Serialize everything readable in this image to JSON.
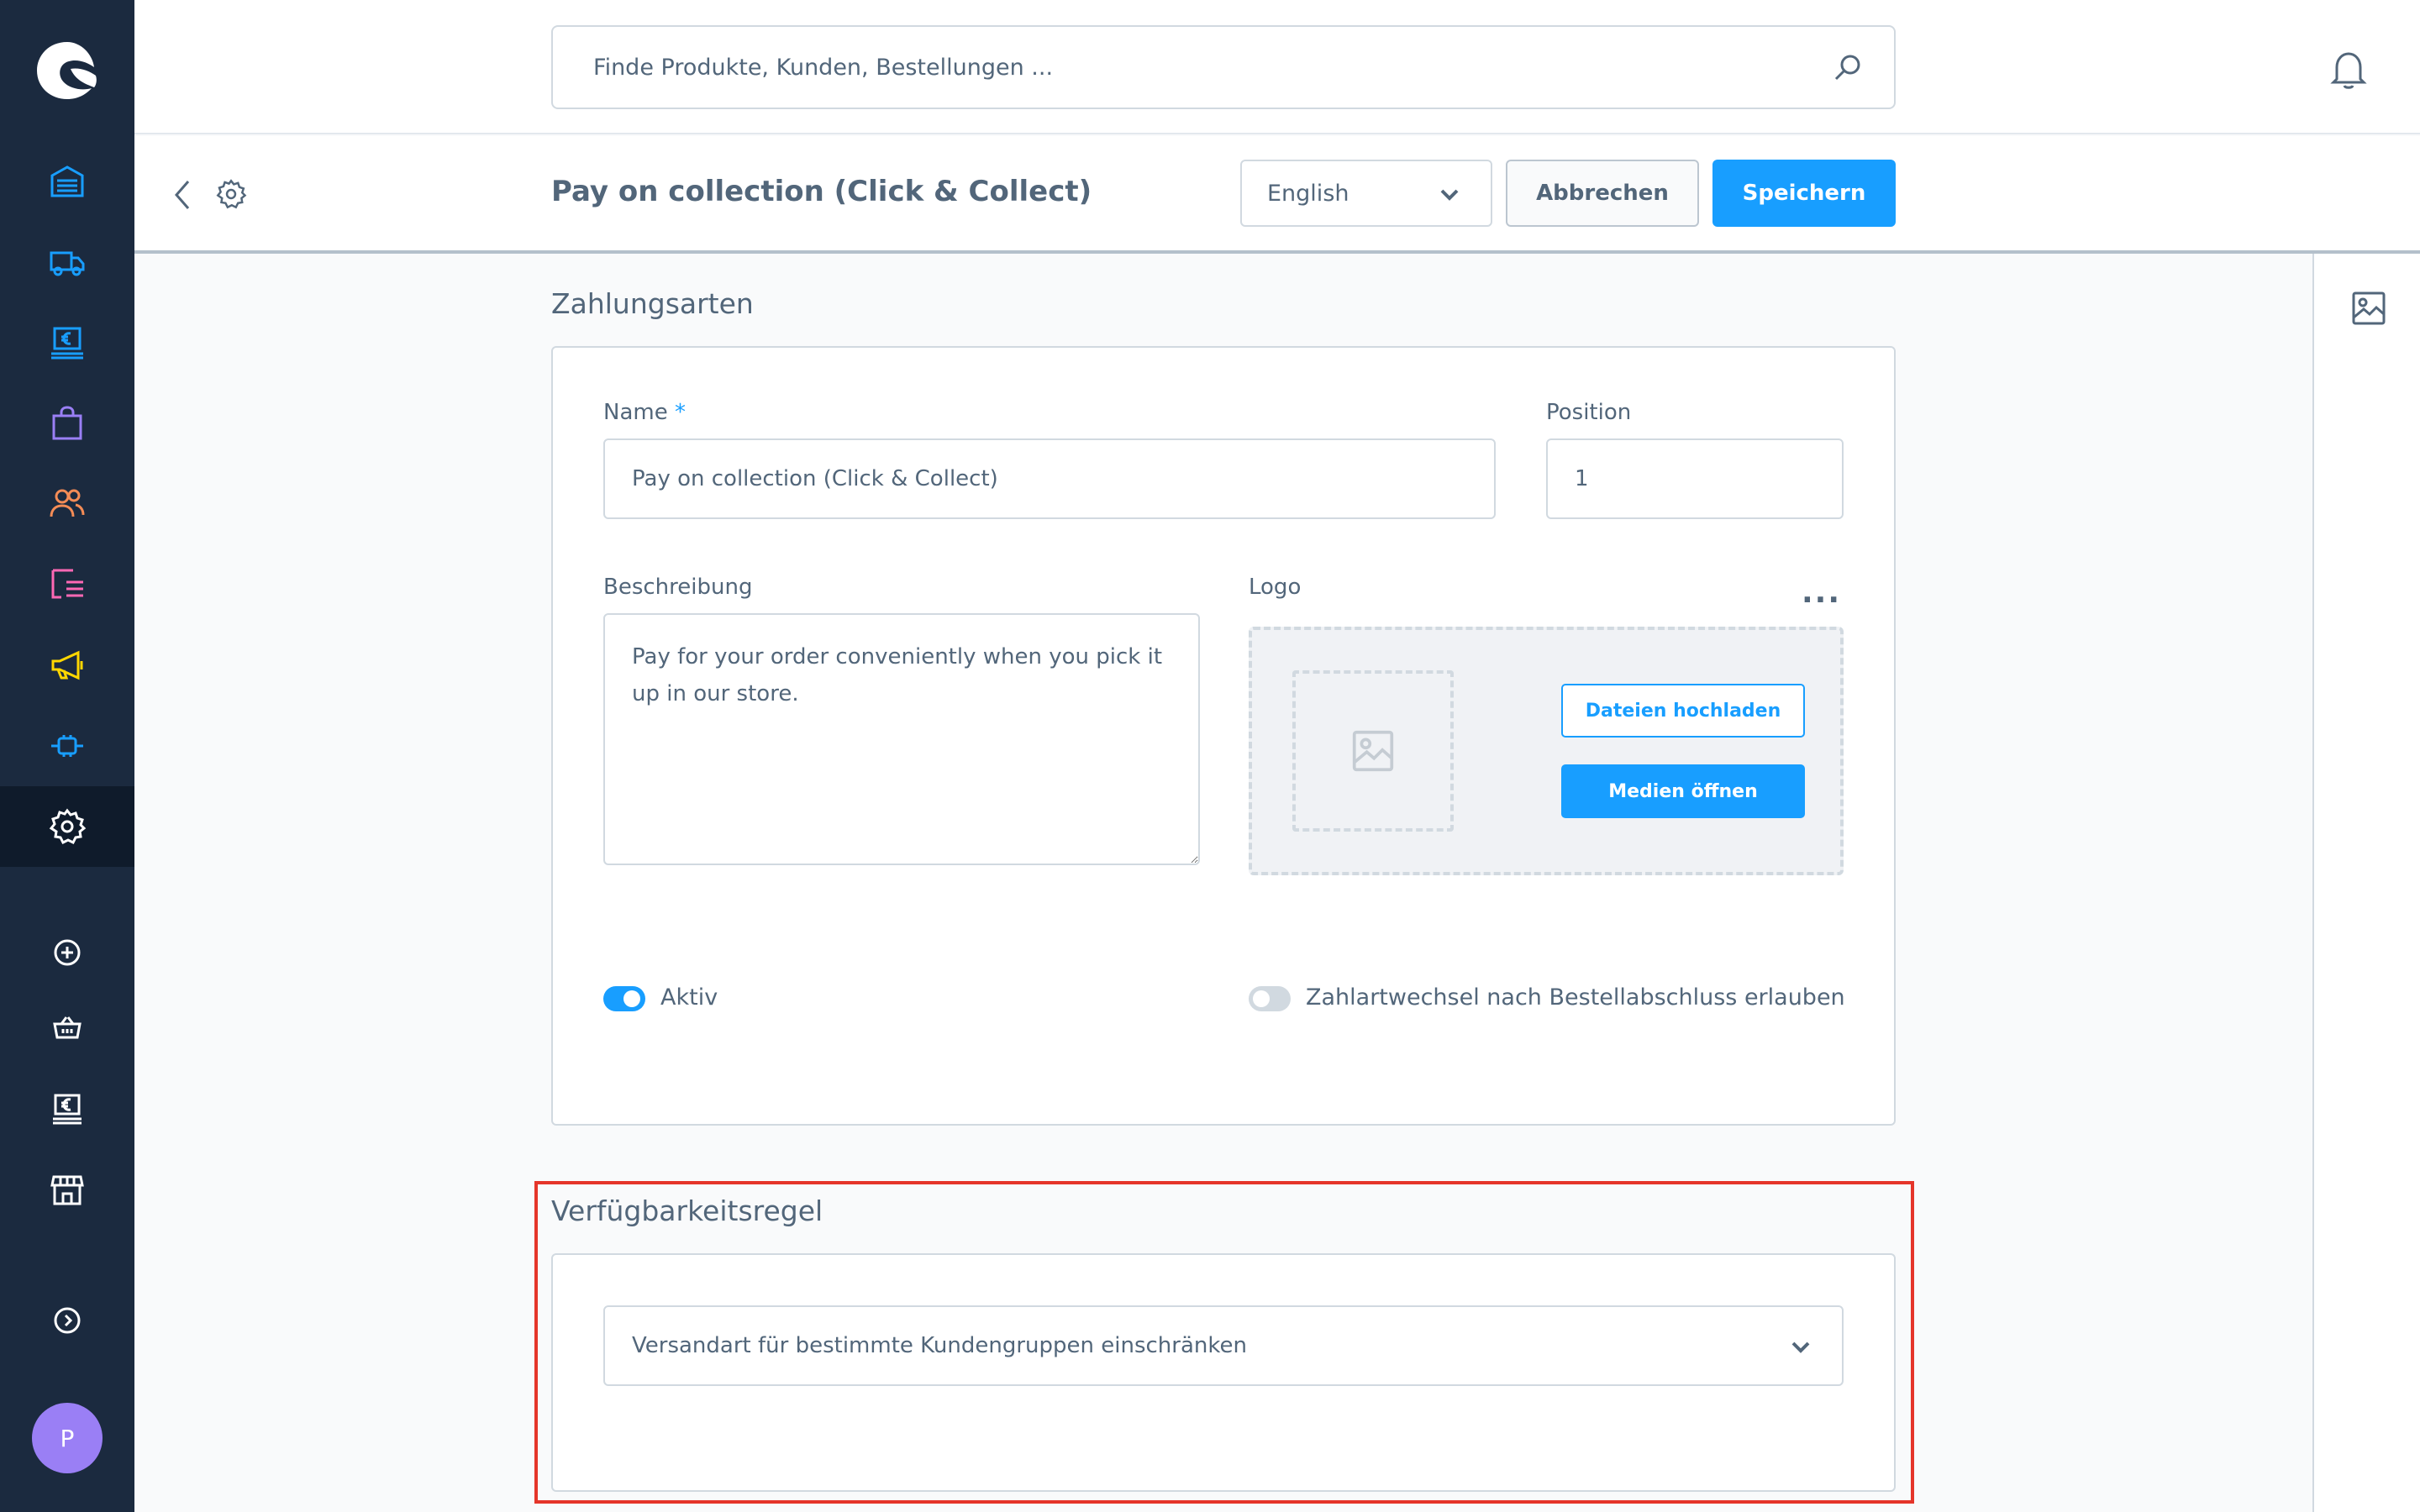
{
  "header": {
    "search_placeholder": "Finde Produkte, Kunden, Bestellungen ..."
  },
  "sidebar": {
    "items": [
      {
        "name": "dashboard",
        "icon": "dashboard-icon",
        "color": "#189eff"
      },
      {
        "name": "shipping",
        "icon": "truck-icon",
        "color": "#189eff"
      },
      {
        "name": "orders",
        "icon": "euro-monitor-icon",
        "color": "#189eff"
      },
      {
        "name": "catalog",
        "icon": "shopping-bag-icon",
        "color": "#9a7ff5"
      },
      {
        "name": "customers",
        "icon": "users-icon",
        "color": "#f48c56"
      },
      {
        "name": "content",
        "icon": "list-icon",
        "color": "#ff68b4"
      },
      {
        "name": "marketing",
        "icon": "megaphone-icon",
        "color": "#ffd700"
      },
      {
        "name": "extensions",
        "icon": "plug-icon",
        "color": "#189eff"
      },
      {
        "name": "settings",
        "icon": "gear-icon",
        "color": "#ffffff",
        "active": true
      }
    ],
    "sales_channels": [
      {
        "name": "add-sales-channel",
        "icon": "plus-circle-icon"
      },
      {
        "name": "storefront",
        "icon": "basket-icon"
      },
      {
        "name": "pos",
        "icon": "euro-monitor-icon"
      },
      {
        "name": "store",
        "icon": "shop-icon"
      }
    ],
    "avatar_initial": "P"
  },
  "smartbar": {
    "title": "Pay on collection (Click & Collect)",
    "language": "English",
    "cancel_label": "Abbrechen",
    "save_label": "Speichern"
  },
  "payment": {
    "section_title": "Zahlungsarten",
    "name_label": "Name",
    "name_required_mark": "*",
    "name_value": "Pay on collection (Click & Collect)",
    "position_label": "Position",
    "position_value": "1",
    "description_label": "Beschreibung",
    "description_value": "Pay for your order conveniently when you pick it up in our store.",
    "logo_label": "Logo",
    "logo_menu": "...",
    "upload_label": "Dateien hochladen",
    "media_label": "Medien öffnen",
    "active_label": "Aktiv",
    "active_value": true,
    "change_label": "Zahlartwechsel nach Bestellabschluss erlauben",
    "change_value": false
  },
  "availability": {
    "section_title": "Verfügbarkeitsregel",
    "rule_value": "Versandart für bestimmte Kundengruppen einschränken"
  },
  "colors": {
    "accent": "#189eff",
    "sidebar_bg": "#1b2a3f",
    "highlight": "#e5352a"
  }
}
